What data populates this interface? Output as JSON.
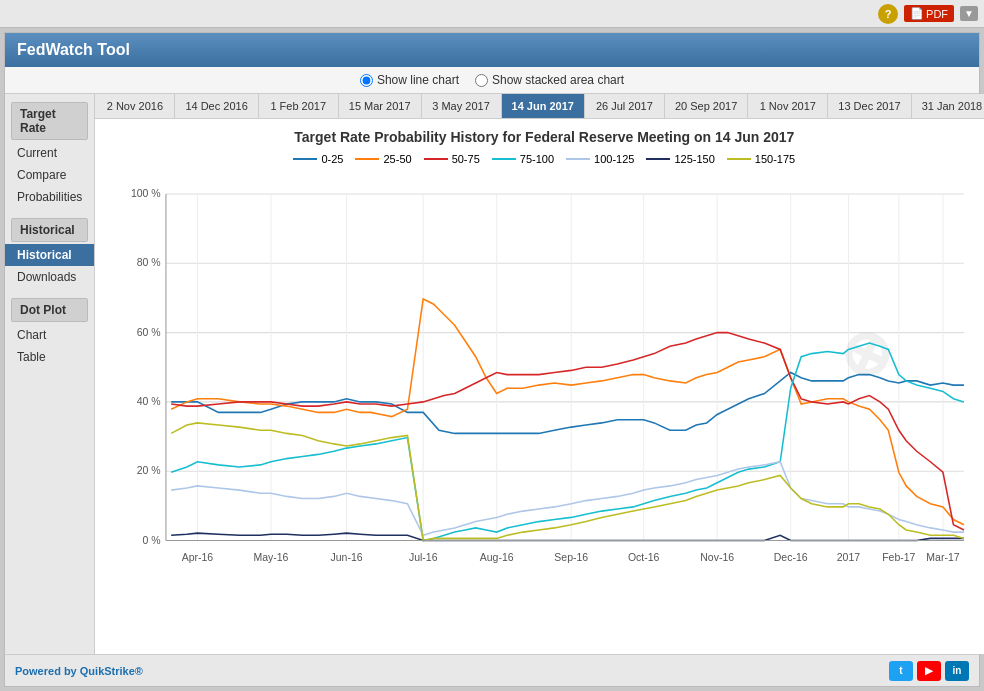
{
  "app": {
    "title": "FedWatch Tool"
  },
  "topbar": {
    "pdf_label": "PDF",
    "help_icon": "?"
  },
  "chart_type": {
    "option1": "Show line chart",
    "option2": "Show stacked area chart"
  },
  "sidebar": {
    "section1": {
      "header": "Target Rate",
      "items": [
        "Current",
        "Compare",
        "Probabilities"
      ]
    },
    "section2": {
      "header": "Historical",
      "items": [
        "Historical",
        "Downloads"
      ]
    },
    "section3": {
      "header": "Dot Plot",
      "items": [
        "Chart",
        "Table"
      ]
    }
  },
  "tabs": [
    "2 Nov 2016",
    "14 Dec 2016",
    "1 Feb 2017",
    "15 Mar 2017",
    "3 May 2017",
    "14 Jun 2017",
    "26 Jul 2017",
    "20 Sep 2017",
    "1 Nov 2017",
    "13 Dec 2017",
    "31 Jan 2018"
  ],
  "active_tab": "14 Jun 2017",
  "chart": {
    "title": "Target Rate Probability History for Federal Reserve Meeting on 14 Jun 2017",
    "y_labels": [
      "100 %",
      "80 %",
      "60 %",
      "40 %",
      "20 %",
      "0 %"
    ],
    "x_labels": [
      "Apr-16",
      "May-16",
      "Jun-16",
      "Jul-16",
      "Aug-16",
      "Sep-16",
      "Oct-16",
      "Nov-16",
      "Dec-16",
      "2017",
      "Feb-17",
      "Mar-17"
    ],
    "legend": [
      {
        "label": "0-25",
        "color": "#1f77b4"
      },
      {
        "label": "25-50",
        "color": "#ff7f0e"
      },
      {
        "label": "50-75",
        "color": "#d62728"
      },
      {
        "label": "75-100",
        "color": "#17becf"
      },
      {
        "label": "100-125",
        "color": "#aec7e8"
      },
      {
        "label": "125-150",
        "color": "#1f3060"
      },
      {
        "label": "150-175",
        "color": "#bcbd22"
      }
    ]
  },
  "footer": {
    "text": "Powered by",
    "brand": "QuikStrike",
    "trademark": "®"
  }
}
